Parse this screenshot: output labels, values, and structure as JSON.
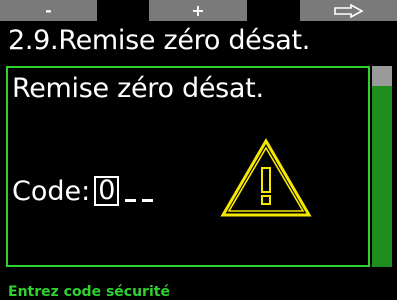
{
  "softkeys": {
    "minus_label": "-",
    "plus_label": "+",
    "next_icon": "arrow-right-outline-icon"
  },
  "header": {
    "title": "2.9.Remise zéro désat."
  },
  "panel": {
    "heading": "Remise zéro désat.",
    "code_label": "Code:",
    "code_active_digit": "0",
    "code_blank_count": 2,
    "warning_icon": "warning-triangle-icon"
  },
  "scrollbar": {
    "position_fraction": 0.0
  },
  "status": {
    "hint": "Entrez code sécurité"
  },
  "colors": {
    "background": "#000000",
    "softkey": "#7a7a7a",
    "accent_green": "#2fd12f",
    "scroll_track": "#1e8f1e",
    "scroll_thumb": "#9a9a9a",
    "warning_yellow": "#f5e800"
  }
}
